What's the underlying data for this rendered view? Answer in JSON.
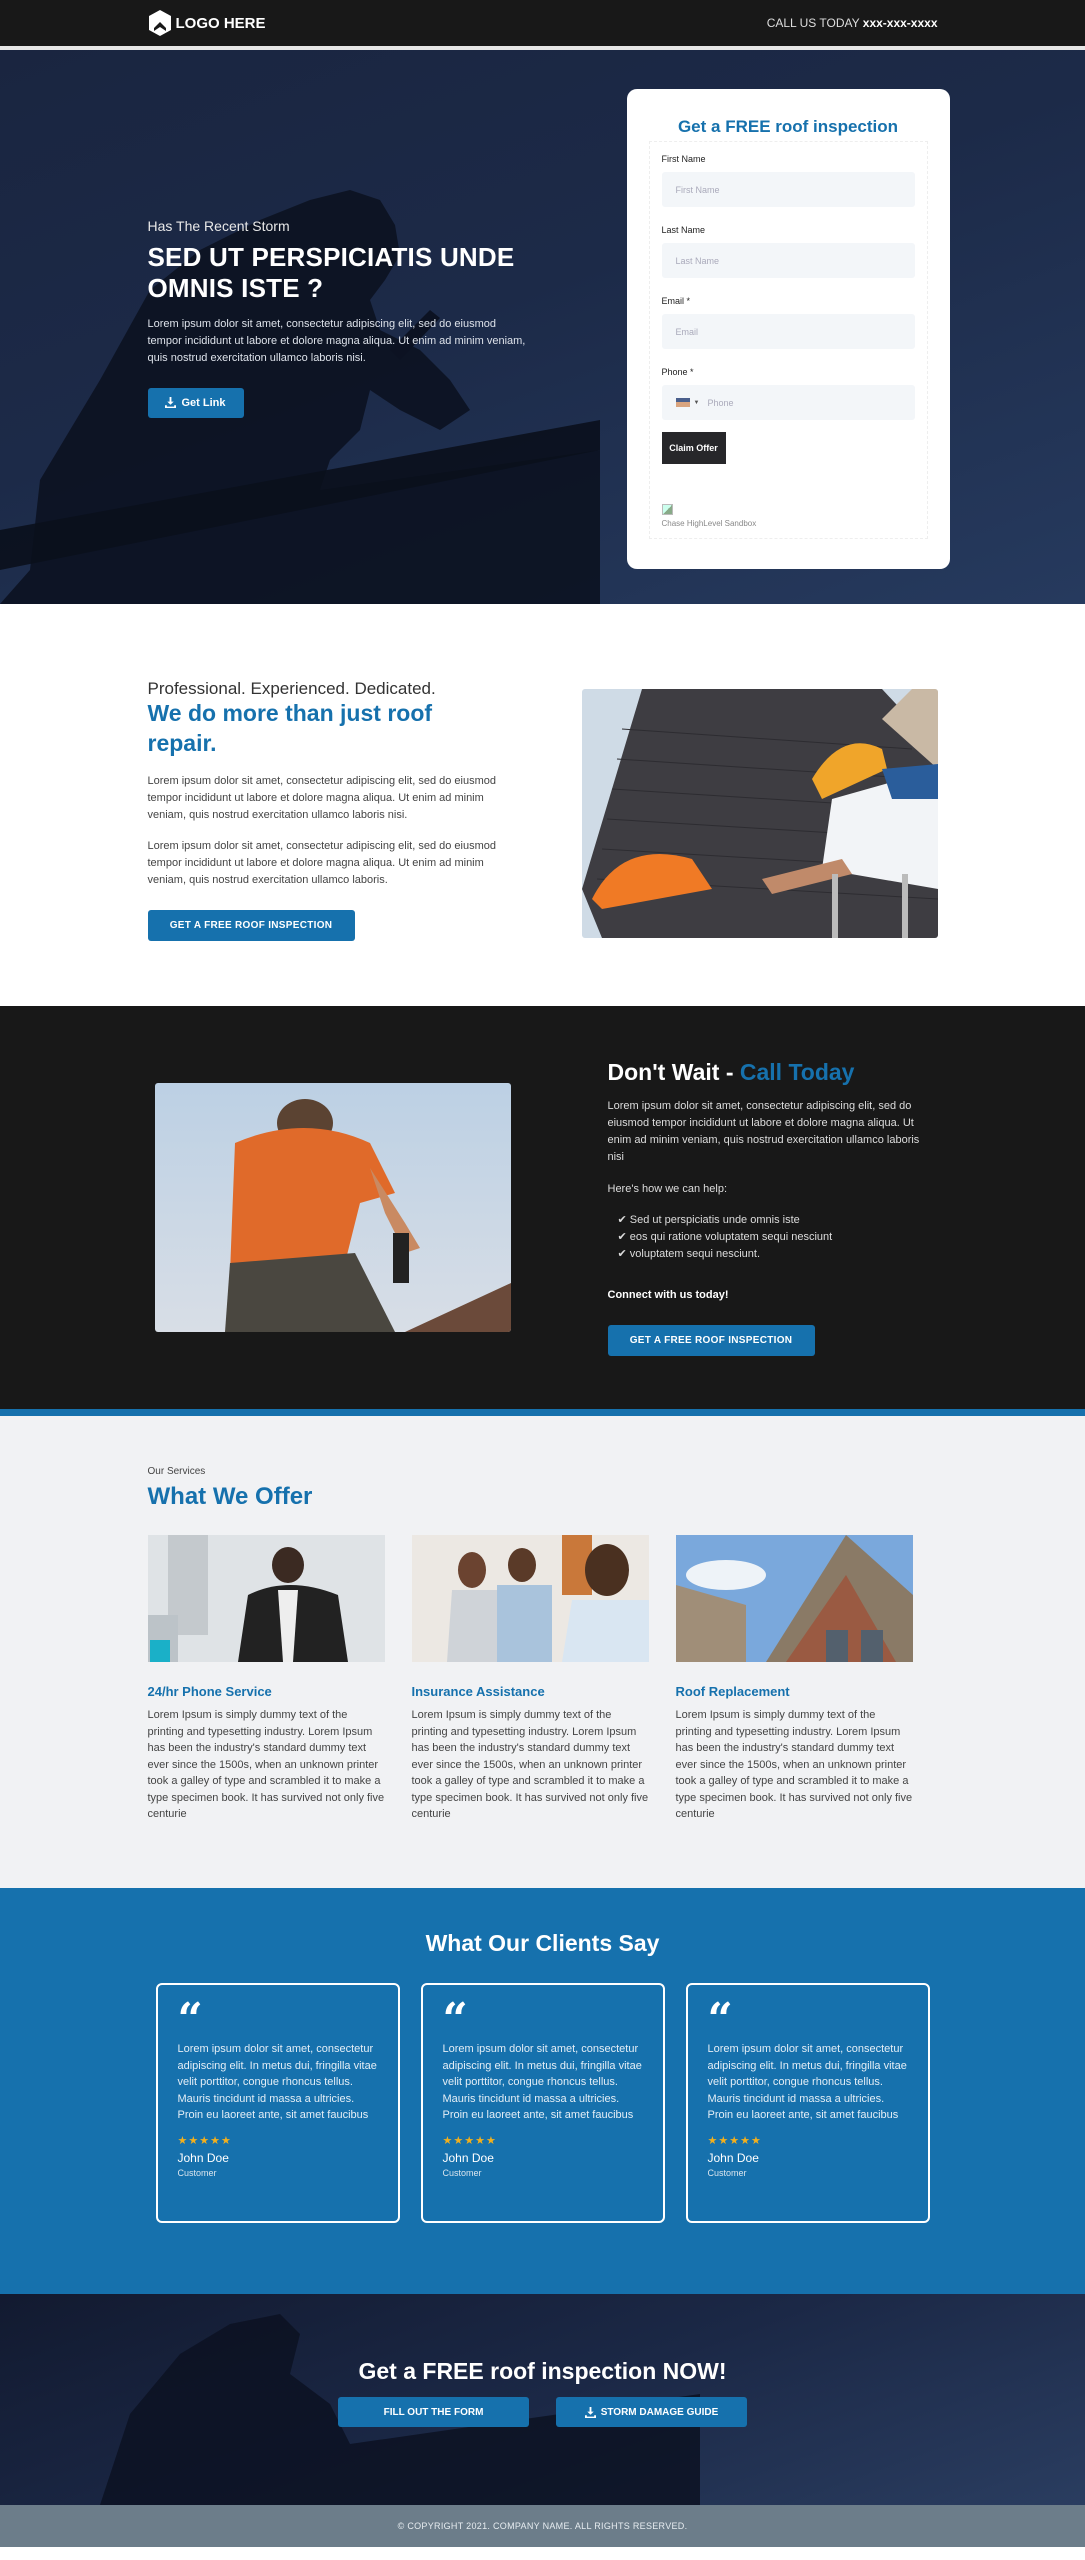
{
  "header": {
    "logo_text": "LOGO HERE",
    "call_label": "CALL US TODAY",
    "phone": "xxx-xxx-xxxx"
  },
  "hero": {
    "kicker": "Has The Recent Storm",
    "title": "SED UT PERSPICIATIS UNDE OMNIS ISTE ?",
    "body": "Lorem ipsum dolor sit amet, consectetur adipiscing elit, sed do eiusmod tempor incididunt ut labore et dolore magna aliqua. Ut enim ad minim veniam, quis nostrud exercitation ullamco laboris nisi.",
    "button": "Get Link"
  },
  "form": {
    "title": "Get a FREE roof inspection",
    "fields": [
      {
        "label": "First Name",
        "placeholder": "First Name",
        "value": ""
      },
      {
        "label": "Last Name",
        "placeholder": "Last Name",
        "value": ""
      },
      {
        "label": "Email *",
        "placeholder": "Email",
        "value": ""
      },
      {
        "label": "Phone *",
        "placeholder": "Phone",
        "value": ""
      }
    ],
    "submit": "Claim Offer",
    "footer_text": "Chase HighLevel Sandbox"
  },
  "about": {
    "kicker": "Professional. Experienced. Dedicated.",
    "title": "We do more than just roof repair.",
    "paragraphs": [
      "Lorem ipsum dolor sit amet, consectetur adipiscing elit, sed do eiusmod tempor incididunt ut labore et dolore magna aliqua. Ut enim ad minim veniam, quis nostrud exercitation ullamco laboris nisi.",
      "Lorem ipsum dolor sit amet, consectetur adipiscing elit, sed do eiusmod tempor incididunt ut labore et dolore magna aliqua. Ut enim ad minim veniam, quis nostrud exercitation ullamco laboris."
    ],
    "button": "GET A FREE ROOF INSPECTION"
  },
  "dont_wait": {
    "title_plain": "Don't Wait - ",
    "title_accent": "Call Today",
    "body": "Lorem ipsum dolor sit amet, consectetur adipiscing elit, sed do eiusmod tempor incididunt ut labore et dolore magna aliqua. Ut enim ad minim veniam, quis nostrud exercitation ullamco laboris nisi",
    "help_label": "Here's how we can help:",
    "checks": [
      "✔ Sed ut perspiciatis unde omnis iste",
      "✔ eos qui ratione voluptatem sequi nesciunt",
      "✔ voluptatem sequi nesciunt."
    ],
    "connect": "Connect with us today!",
    "button": "GET A FREE ROOF INSPECTION"
  },
  "services": {
    "kicker": "Our Services",
    "title": "What We Offer",
    "items": [
      {
        "name": "24/hr Phone Service",
        "body": "Lorem Ipsum is simply dummy text of the printing and typesetting industry. Lorem Ipsum has been the industry's standard dummy text ever since the 1500s, when an unknown printer took a galley of type and scrambled it to make a type specimen book. It has survived not only five centurie"
      },
      {
        "name": "Insurance Assistance",
        "body": "Lorem Ipsum is simply dummy text of the printing and typesetting industry. Lorem Ipsum has been the industry's standard dummy text ever since the 1500s, when an unknown printer took a galley of type and scrambled it to make a type specimen book. It has survived not only five centurie"
      },
      {
        "name": "Roof Replacement",
        "body": "Lorem Ipsum is simply dummy text of the printing and typesetting industry. Lorem Ipsum has been the industry's standard dummy text ever since the 1500s, when an unknown printer took a galley of type and scrambled it to make a type specimen book. It has survived not only five centurie"
      }
    ]
  },
  "testimonials": {
    "title": "What Our Clients Say",
    "items": [
      {
        "quote_mark": "“",
        "body": "Lorem ipsum dolor sit amet, consectetur adipiscing elit. In metus dui, fringilla vitae velit porttitor, congue rhoncus tellus. Mauris tincidunt id massa a ultricies. Proin eu laoreet ante, sit amet faucibus",
        "rating": 5,
        "stars": "★★★★★",
        "name": "John Doe",
        "role": "Customer"
      },
      {
        "quote_mark": "“",
        "body": "Lorem ipsum dolor sit amet, consectetur adipiscing elit. In metus dui, fringilla vitae velit porttitor, congue rhoncus tellus. Mauris tincidunt id massa a ultricies. Proin eu laoreet ante, sit amet faucibus",
        "rating": 5,
        "stars": "★★★★★",
        "name": "John Doe",
        "role": "Customer"
      },
      {
        "quote_mark": "“",
        "body": "Lorem ipsum dolor sit amet, consectetur adipiscing elit. In metus dui, fringilla vitae velit porttitor, congue rhoncus tellus. Mauris tincidunt id massa a ultricies. Proin eu laoreet ante, sit amet faucibus",
        "rating": 5,
        "stars": "★★★★★",
        "name": "John Doe",
        "role": "Customer"
      }
    ]
  },
  "bottom_cta": {
    "title": "Get a FREE roof inspection NOW!",
    "button_form": "FILL OUT THE FORM",
    "button_guide": "STORM DAMAGE GUIDE"
  },
  "footer": {
    "copyright": "© COPYRIGHT 2021. COMPANY NAME. ALL RIGHTS RESERVED."
  },
  "colors": {
    "brand_blue": "#1671ad",
    "dark": "#181818",
    "star": "#f2b01e"
  }
}
